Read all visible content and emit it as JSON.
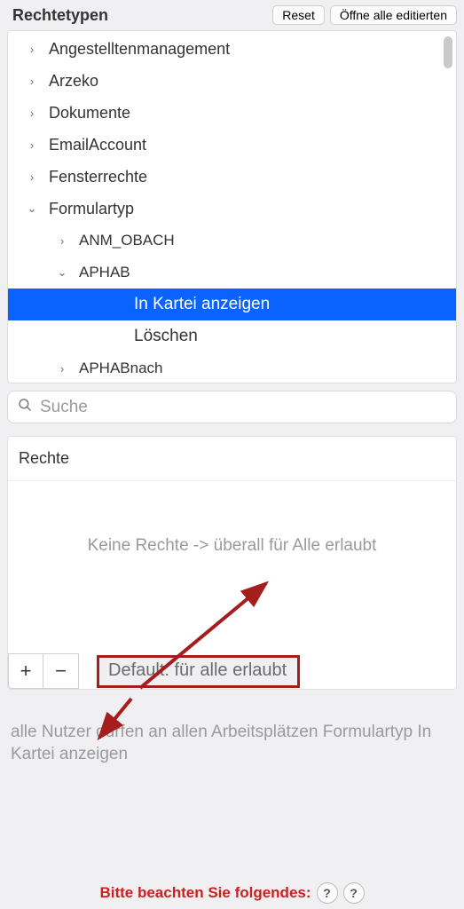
{
  "header": {
    "title": "Rechtetypen",
    "reset_label": "Reset",
    "open_edited_label": "Öffne alle editierten"
  },
  "tree": {
    "items": [
      {
        "label": "Angestelltenmanagement",
        "level": 0,
        "chev": "right",
        "selected": false
      },
      {
        "label": "Arzeko",
        "level": 0,
        "chev": "right",
        "selected": false
      },
      {
        "label": "Dokumente",
        "level": 0,
        "chev": "right",
        "selected": false
      },
      {
        "label": "EmailAccount",
        "level": 0,
        "chev": "right",
        "selected": false
      },
      {
        "label": "Fensterrechte",
        "level": 0,
        "chev": "right",
        "selected": false
      },
      {
        "label": "Formulartyp",
        "level": 0,
        "chev": "down",
        "selected": false
      },
      {
        "label": "ANM_OBACH",
        "level": 1,
        "chev": "right",
        "selected": false
      },
      {
        "label": "APHAB",
        "level": 1,
        "chev": "down",
        "selected": false
      },
      {
        "label": "In Kartei anzeigen",
        "level": 2,
        "chev": "",
        "selected": true
      },
      {
        "label": "Löschen",
        "level": 2,
        "chev": "",
        "selected": false
      },
      {
        "label": "APHABnach",
        "level": 1,
        "chev": "right",
        "selected": false
      }
    ]
  },
  "search": {
    "placeholder": "Suche"
  },
  "rechte": {
    "title": "Rechte",
    "empty_message": "Keine Rechte -> überall für Alle erlaubt",
    "plus_label": "+",
    "minus_label": "−",
    "default_label": "Default: für alle erlaubt"
  },
  "description": "alle Nutzer dürfen an allen Arbeitsplätzen Formulartyp In Kartei anzeigen",
  "footer": {
    "warning": "Bitte beachten Sie folgendes:",
    "help_glyph": "?"
  },
  "icons": {
    "chev_right": "›",
    "chev_down": "⌄"
  }
}
